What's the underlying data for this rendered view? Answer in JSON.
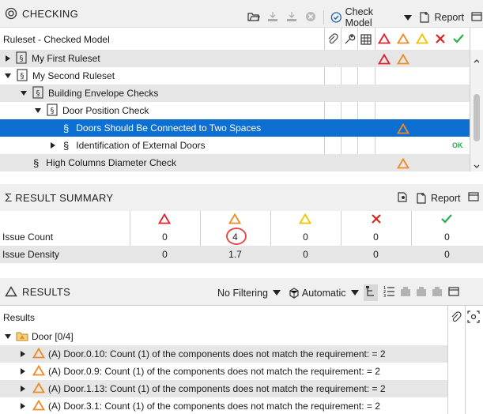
{
  "checking": {
    "title": "CHECKING",
    "check_model_label": "Check Model",
    "report_label": "Report",
    "column_header": "Ruleset - Checked Model",
    "tree": [
      {
        "label": "My First Ruleset",
        "severities": [
          "critical",
          "major"
        ]
      },
      {
        "label": "My Second Ruleset",
        "severities": []
      },
      {
        "label": "Building Envelope Checks",
        "severities": []
      },
      {
        "label": "Door Position Check",
        "severities": []
      },
      {
        "label": "Doors Should Be Connected to Two Spaces",
        "severities": [
          "major"
        ]
      },
      {
        "label": "Identification of External Doors",
        "ok_badge": "OK"
      },
      {
        "label": "High Columns Diameter Check",
        "severities": [
          "major"
        ]
      }
    ]
  },
  "summary": {
    "title": "RESULT SUMMARY",
    "report_label": "Report",
    "rows": [
      {
        "label": "Issue Count",
        "values": [
          "0",
          "4",
          "0",
          "0",
          "0"
        ]
      },
      {
        "label": "Issue Density",
        "values": [
          "0",
          "1.7",
          "0",
          "0",
          "0"
        ]
      }
    ]
  },
  "results": {
    "title": "RESULTS",
    "filter_label": "No Filtering",
    "mode_label": "Automatic",
    "column_header": "Results",
    "group_label": "Door [0/4]",
    "items": [
      {
        "label": "(A) Door.0.10: Count (1) of the components does not match the requirement: = 2"
      },
      {
        "label": "(A) Door.0.9: Count (1) of the components does not match the requirement: = 2"
      },
      {
        "label": "(A) Door.1.13: Count (1) of the components does not match the requirement: = 2"
      },
      {
        "label": "(A) Door.3.1: Count (1) of the components does not match the requirement: = 2"
      }
    ]
  },
  "colors": {
    "critical": "#e0202a",
    "major": "#f08a24",
    "minor": "#f2c200",
    "rejected": "#d9261c",
    "accepted": "#22b14c",
    "selection": "#0c6fd1"
  }
}
